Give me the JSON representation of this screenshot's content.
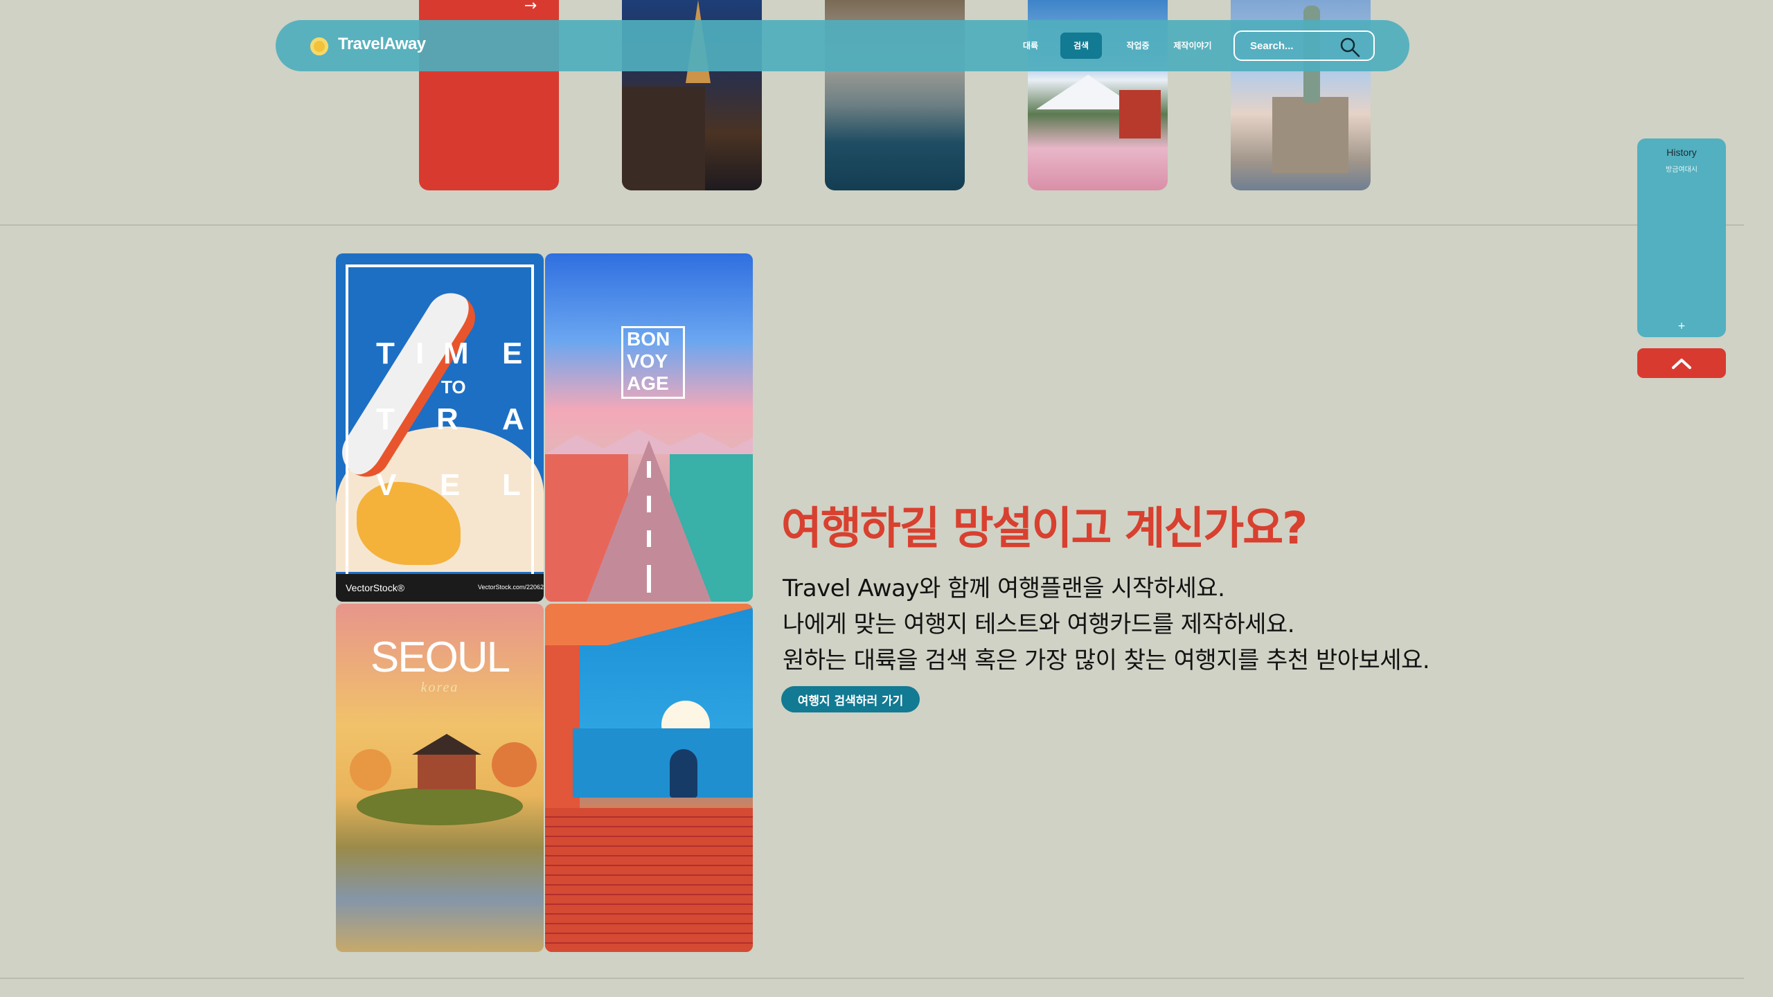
{
  "navbar": {
    "brand": "TravelAway",
    "items": [
      {
        "label": "대륙",
        "active": false
      },
      {
        "label": "검색",
        "active": true
      },
      {
        "label": "작업중",
        "active": false
      },
      {
        "label": "제작이야기",
        "active": false
      }
    ],
    "search_placeholder": "Search...",
    "accent_color": "#127a93"
  },
  "top_strip": {
    "cards": [
      {
        "name": "red-card",
        "icon": "arrow-right-icon"
      },
      {
        "name": "paris"
      },
      {
        "name": "coast"
      },
      {
        "name": "mount-fuji"
      },
      {
        "name": "statue-of-liberty"
      }
    ]
  },
  "posters": {
    "travel": {
      "letters": [
        "T",
        "I",
        "M",
        "E",
        "TO",
        "T",
        "R",
        "A",
        "V",
        "E",
        "L"
      ],
      "brand": "VectorStock®",
      "brand_url": "VectorStock.com/22062"
    },
    "bon_voyage": {
      "lines": [
        "BON",
        "VOY",
        "AGE"
      ]
    },
    "seoul": {
      "title": "SEOUL",
      "subtitle": "korea"
    },
    "pool": {}
  },
  "hero": {
    "headline": "여행하길 망설이고 계신가요?",
    "lines": [
      "Travel Away와 함께 여행플랜을 시작하세요.",
      "나에게 맞는 여행지 테스트와 여행카드를 제작하세요.",
      "원하는 대륙을 검색 혹은 가장 많이 찾는 여행지를 추천 받아보세요."
    ],
    "cta": "여행지 검색하러 가기",
    "headline_color": "#d8402f"
  },
  "side_panel": {
    "title": "History",
    "subtitle": "방금여대시",
    "plus": "+",
    "top_button_icon": "chevron-up-icon"
  }
}
